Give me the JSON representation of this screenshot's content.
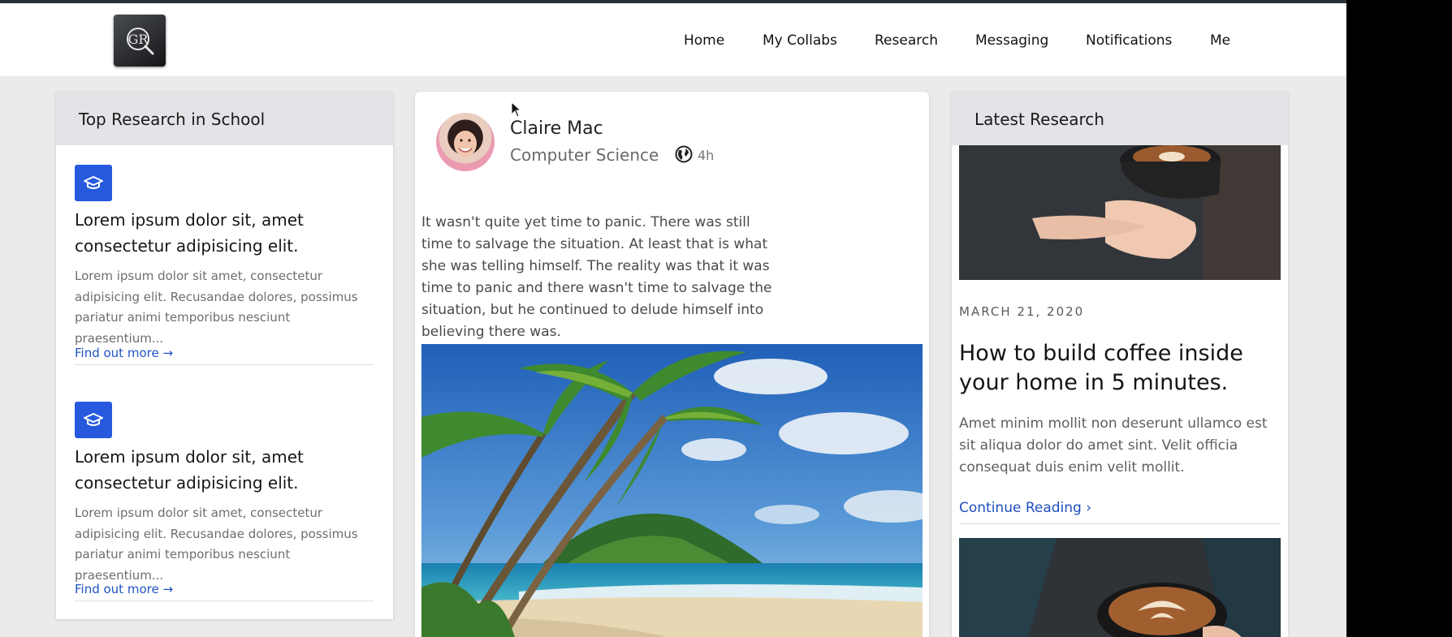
{
  "nav": {
    "logo_text": "GR",
    "items": [
      "Home",
      "My Collabs",
      "Research",
      "Messaging",
      "Notifications",
      "Me"
    ]
  },
  "left": {
    "header": "Top Research in School",
    "items": [
      {
        "icon": "graduation-cap-icon",
        "title": "Lorem ipsum dolor sit, amet consectetur adipisicing elit.",
        "desc": "Lorem ipsum dolor sit amet, consectetur adipisicing elit. Recusandae dolores, possimus pariatur animi temporibus nesciunt praesentium...",
        "link": "Find out more →"
      },
      {
        "icon": "graduation-cap-icon",
        "title": "Lorem ipsum dolor sit, amet consectetur adipisicing elit.",
        "desc": "Lorem ipsum dolor sit amet, consectetur adipisicing elit. Recusandae dolores, possimus pariatur animi temporibus nesciunt praesentium...",
        "link": "Find out more →"
      }
    ]
  },
  "post": {
    "author": "Claire Mac",
    "department": "Computer Science",
    "visibility_icon": "globe-icon",
    "time": "4h",
    "body": "It wasn't quite yet time to panic. There was still time to salvage the situation. At least that is what she was telling himself. The reality was that it was time to panic and there wasn't time to salvage the situation, but he continued to delude himself into believing there was."
  },
  "right": {
    "header": "Latest Research",
    "date": "MARCH 21, 2020",
    "title": "How to build coffee inside your home in 5 minutes.",
    "desc": "Amet minim mollit non deserunt ullamco est sit aliqua dolor do amet sint. Velit officia consequat duis enim velit mollit.",
    "link": "Continue Reading ›"
  },
  "colors": {
    "accent": "#2659de",
    "link": "#2153c4",
    "page_bg": "#ebebeb",
    "header_bg": "#e3e4e7"
  }
}
